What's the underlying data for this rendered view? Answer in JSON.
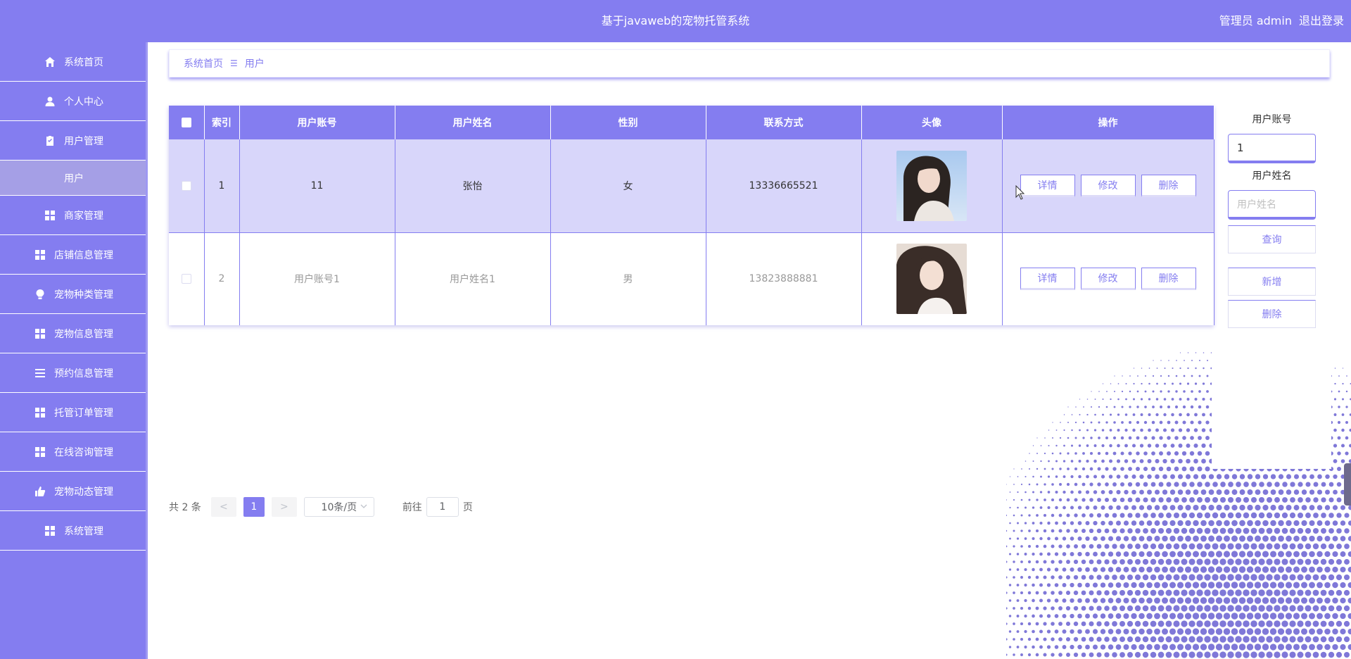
{
  "app": {
    "title": "基于javaweb的宠物托管系统",
    "user_label": "管理员 admin",
    "logout_label": "退出登录"
  },
  "sidebar": {
    "items": [
      {
        "label": "系统首页",
        "icon": "home-icon"
      },
      {
        "label": "个人中心",
        "icon": "user-icon"
      },
      {
        "label": "用户管理",
        "icon": "clipboard-icon"
      },
      {
        "label": "商家管理",
        "icon": "grid-icon"
      },
      {
        "label": "店铺信息管理",
        "icon": "grid-icon"
      },
      {
        "label": "宠物种类管理",
        "icon": "bulb-icon"
      },
      {
        "label": "宠物信息管理",
        "icon": "grid-icon"
      },
      {
        "label": "预约信息管理",
        "icon": "list-icon"
      },
      {
        "label": "托管订单管理",
        "icon": "grid-icon"
      },
      {
        "label": "在线咨询管理",
        "icon": "grid-icon"
      },
      {
        "label": "宠物动态管理",
        "icon": "thumb-icon"
      },
      {
        "label": "系统管理",
        "icon": "grid-icon"
      }
    ],
    "active_sub": "用户"
  },
  "breadcrumb": {
    "home": "系统首页",
    "current": "用户"
  },
  "table": {
    "columns": [
      "索引",
      "用户账号",
      "用户姓名",
      "性别",
      "联系方式",
      "头像",
      "操作"
    ],
    "rows": [
      {
        "index": "1",
        "account": "11",
        "name": "张怡",
        "gender": "女",
        "phone": "13336665521"
      },
      {
        "index": "2",
        "account": "用户账号1",
        "name": "用户姓名1",
        "gender": "男",
        "phone": "13823888881"
      }
    ],
    "actions": {
      "detail": "详情",
      "edit": "修改",
      "delete": "删除"
    }
  },
  "search": {
    "account_label": "用户账号",
    "account_value": "1",
    "name_label": "用户姓名",
    "name_placeholder": "用户姓名",
    "query_label": "查询",
    "add_label": "新增",
    "delete_label": "删除"
  },
  "pager": {
    "total_text": "共 2 条",
    "prev": "<",
    "current_page": "1",
    "next": ">",
    "page_size": "10条/页",
    "goto_prefix": "前往",
    "goto_value": "1",
    "goto_suffix": "页"
  },
  "colors": {
    "primary": "#847df0",
    "row_highlight": "#d8d6fa",
    "sub_active": "#a59fe6"
  }
}
